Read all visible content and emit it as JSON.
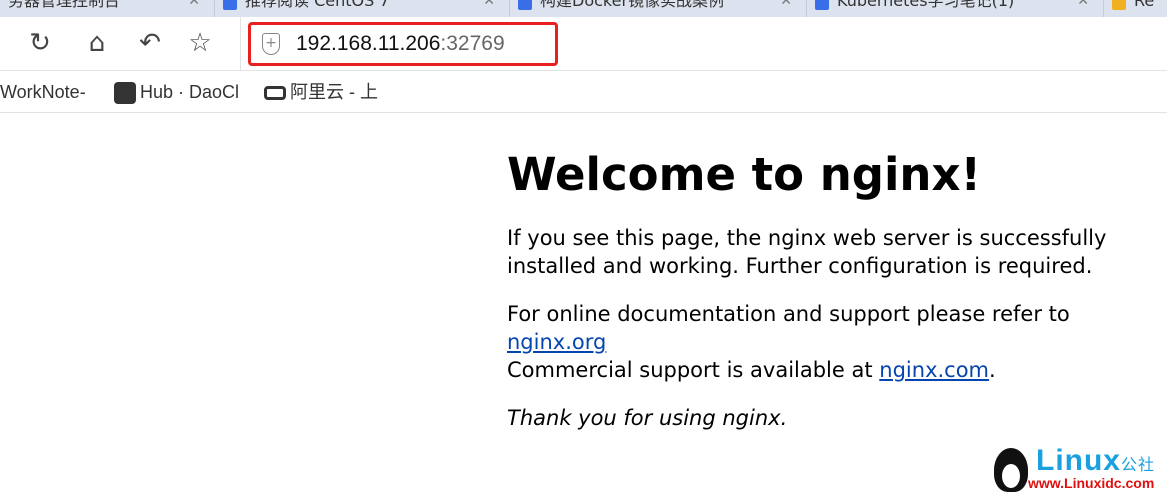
{
  "tabs": [
    {
      "label": "务器管理控制台"
    },
    {
      "label": "推荐阅读 CentOS 7"
    },
    {
      "label": "构建Docker镜像实战案例"
    },
    {
      "label": "Kubernetes学习笔记(1)"
    },
    {
      "label": "Re"
    }
  ],
  "address": {
    "host": "192.168.11.206",
    "port": ":32769"
  },
  "bookmarks": [
    {
      "label": "WorkNote-"
    },
    {
      "label": "Hub · DaoCl"
    },
    {
      "label": "阿里云 - 上"
    }
  ],
  "page": {
    "title": "Welcome to nginx!",
    "p1": "If you see this page, the nginx web server is successfully installed and",
    "p1b": "working. Further configuration is required.",
    "p2": "For online documentation and support please refer to ",
    "link1": "nginx.org",
    "p2b": "Commercial support is available at ",
    "link2": "nginx.com",
    "p2c": ".",
    "p3": "Thank you for using nginx."
  },
  "watermark": {
    "brand": "Linux",
    "cn": "公社",
    "url": "www.Linuxidc.com"
  }
}
